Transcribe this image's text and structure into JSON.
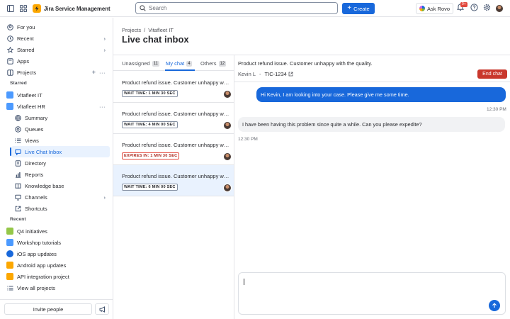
{
  "app": {
    "name": "Jira Service Management",
    "brand_color": "#fca700"
  },
  "topbar": {
    "search_placeholder": "Search",
    "create_label": "Create",
    "ask_rovo_label": "Ask Rovo",
    "notifications_count": "9+"
  },
  "sidebar": {
    "for_you": "For you",
    "recent": "Recent",
    "starred": "Starred",
    "apps": "Apps",
    "projects": "Projects",
    "starred_section": "Starred",
    "starred_projects": [
      {
        "label": "Vitafleet IT",
        "icon_color": "#4c9aff"
      },
      {
        "label": "Vitafleet HR",
        "icon_color": "#4c9aff"
      }
    ],
    "hr_items": [
      {
        "label": "Summary",
        "icon": "globe-icon"
      },
      {
        "label": "Queues",
        "icon": "queues-icon"
      },
      {
        "label": "Views",
        "icon": "list-icon"
      },
      {
        "label": "Live Chat Inbox",
        "icon": "chat-icon"
      },
      {
        "label": "Directory",
        "icon": "directory-icon"
      },
      {
        "label": "Reports",
        "icon": "chart-icon"
      },
      {
        "label": "Knowledge base",
        "icon": "book-icon"
      },
      {
        "label": "Channels",
        "icon": "channels-icon"
      },
      {
        "label": "Shortcuts",
        "icon": "shortcut-icon"
      }
    ],
    "recent_section": "Recent",
    "recent_projects": [
      {
        "label": "Q4 initiatives",
        "icon_color": "#94c748"
      },
      {
        "label": "Workshop tutorials",
        "icon_color": "#4c9aff"
      },
      {
        "label": "iOS app updates",
        "icon_color": "#1868db"
      },
      {
        "label": "Android app updates",
        "icon_color": "#fca700"
      },
      {
        "label": "API integration project",
        "icon_color": "#fca700"
      }
    ],
    "view_all": "View all projects",
    "invite_label": "Invite people"
  },
  "main": {
    "breadcrumb": [
      "Projects",
      "/",
      "Vitafleet IT"
    ],
    "title": "Live chat inbox"
  },
  "inbox": {
    "tabs": [
      {
        "label": "Unassigned",
        "count": "11"
      },
      {
        "label": "My chat",
        "count": "4"
      },
      {
        "label": "Others",
        "count": "12"
      }
    ],
    "chats": [
      {
        "title": "Product refund issue. Customer unhappy with the quality.",
        "timer": "WAIT TIME: 1 MIN 30 SEC",
        "status": "normal"
      },
      {
        "title": "Product refund issue. Customer unhappy with the quality.",
        "timer": "WAIT TIME: 4 MIN 00 SEC",
        "status": "normal"
      },
      {
        "title": "Product refund issue. Customer unhappy with the quality.",
        "timer": "EXPIRES IN: 1 MIN 30 SEC",
        "status": "danger"
      },
      {
        "title": "Product refund issue. Customer unhappy with the quality.",
        "timer": "WAIT TIME: 6 MIN 00 SEC",
        "status": "normal"
      }
    ]
  },
  "conversation": {
    "title": "Product refund issue. Customer unhappy with the quality.",
    "customer": "Kevin L",
    "separator": "-",
    "ticket": "TIC-1234",
    "end_chat_label": "End chat",
    "messages": [
      {
        "text": "Hi Kevin, I am looking into your case. Please give me some time.",
        "time": "12:30 PM",
        "direction": "out"
      },
      {
        "text": "I have been having this problem since quite a while. Can you please expedite?",
        "time": "12:30 PM",
        "direction": "in"
      }
    ],
    "composer_value": "",
    "accent": "#1868db",
    "danger": "#c9372c"
  }
}
